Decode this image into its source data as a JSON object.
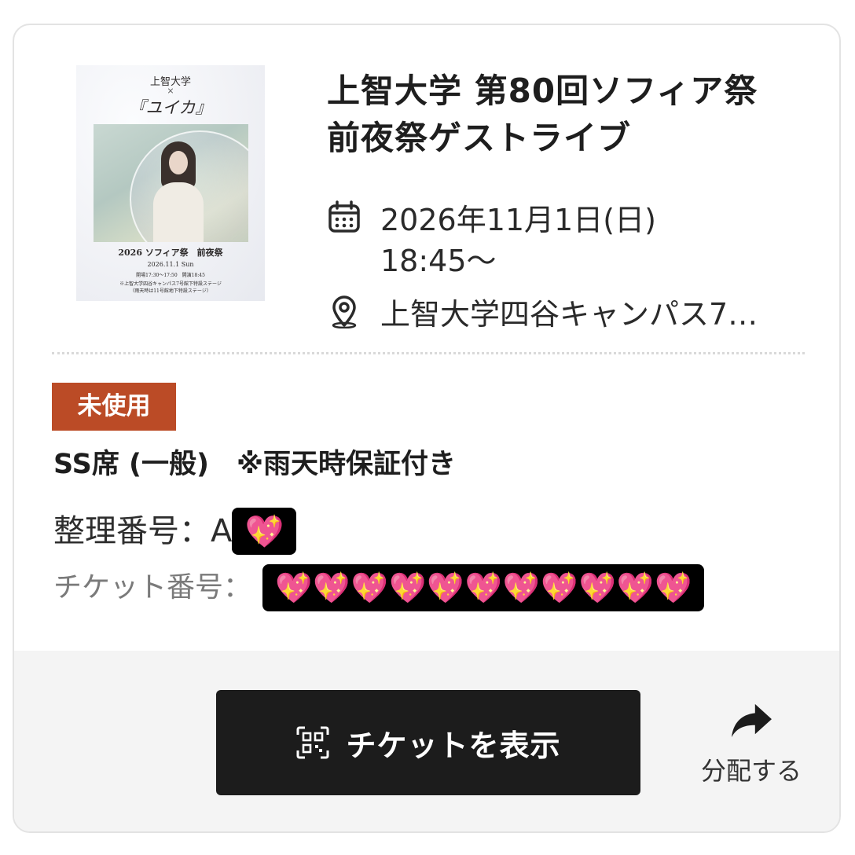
{
  "poster": {
    "title": "上智大学",
    "x_mark": "×",
    "artist": "『ユイカ』",
    "event": "2026 ソフィア祭　前夜祭",
    "date": "2026.11.1 Sun",
    "hours": "開場17:30〜17:50　開演18:45",
    "note1": "※上智大学四谷キャンパス7号館下特設ステージ",
    "note2": "（雨天時は11号館地下特設ステージ）"
  },
  "event": {
    "title": "上智大学 第80回ソフィア祭 前夜祭ゲストライブ",
    "date_line1": "2026年11月1日(日)",
    "date_line2": "18:45〜",
    "venue": "上智大学四谷キャンパス7…",
    "calendar_icon": "calendar-icon",
    "location_icon": "location-pin-icon"
  },
  "ticket": {
    "status": "未使用",
    "seat_type": "SS席 (一般)　※雨天時保証付き",
    "seq_label": "整理番号：",
    "seq_prefix": "A",
    "seq_redacted": "💖",
    "ticket_label": "チケット番号：",
    "ticket_redacted": "💖💖💖💖💖💖💖💖💖💖💖"
  },
  "actions": {
    "show_ticket": "チケットを表示",
    "share": "分配する",
    "qr_icon": "qr-code-icon",
    "share_icon": "share-arrow-icon"
  },
  "colors": {
    "status_badge": "#bb4b26",
    "button": "#1c1c1c",
    "action_bar": "#f4f4f4",
    "redaction": "#000000"
  }
}
